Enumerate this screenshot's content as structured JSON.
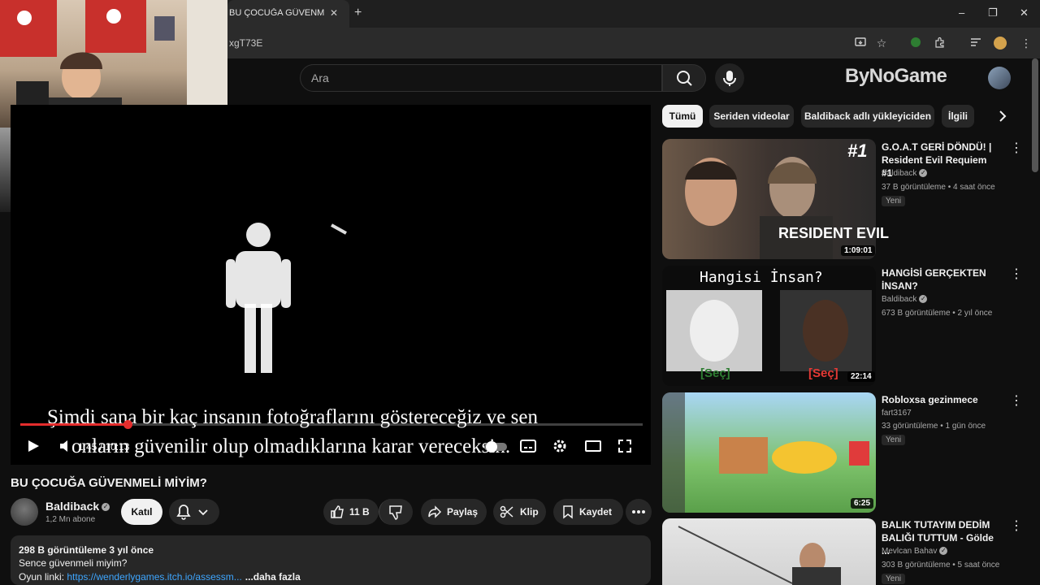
{
  "browser": {
    "tab_title": "BU ÇOCUĞA GÜVENMELİ MİYİM",
    "tab_close": "✕",
    "new_tab": "+",
    "url": "xgT73E",
    "win_min": "–",
    "win_max": "❐",
    "win_close": "✕"
  },
  "header": {
    "search_placeholder": "Ara",
    "watermark": "ByNoGame"
  },
  "player": {
    "time": "1:45 / 10:13",
    "progress_fraction": 0.172,
    "subtitle_line1": "Şimdi sana bir kaç insanın fotoğraflarını göstereceğiz ve sen",
    "subtitle_line2": "onların güvenilir olup olmadıklarına karar vereceksin."
  },
  "video": {
    "title": "BU ÇOCUĞA GÜVENMELİ MİYİM?",
    "channel": "Baldiback",
    "subscribers": "1,2 Mn abone",
    "join": "Katıl",
    "likes": "11 B",
    "share": "Paylaş",
    "clip": "Klip",
    "save": "Kaydet",
    "views_date": "298 B görüntüleme  3 yıl önce",
    "desc_line1": "Sence güvenmeli miyim?",
    "desc_prefix": "Oyun linki: ",
    "desc_link": "https://wenderlygames.itch.io/assessm...",
    "desc_more": "...daha fazla"
  },
  "chips": [
    "Tümü",
    "Seriden videolar",
    "Baldiback adlı yükleyiciden",
    "İlgili"
  ],
  "recommendations": [
    {
      "title": "G.O.A.T GERİ DÖNDÜ! | Resident Evil Requiem #1",
      "channel": "Baldiback",
      "meta": "37 B görüntüleme • 4 saat önce",
      "badge": "Yeni",
      "duration": "1:09:01",
      "thumb_text": "#1",
      "thumb_text2": "RESIDENT EVIL"
    },
    {
      "title": "HANGİSİ GERÇEKTEN İNSAN?",
      "channel": "Baldiback",
      "meta": "673 B görüntüleme • 2 yıl önce",
      "badge": "",
      "duration": "22:14",
      "thumb_text": "Hangisi İnsan?",
      "thumb_text2": "[Seç]"
    },
    {
      "title": "Robloxsa gezinmece",
      "channel": "fart3167",
      "meta": "33 görüntüleme • 1 gün önce",
      "badge": "Yeni",
      "duration": "6:25",
      "thumb_text": "",
      "thumb_text2": ""
    },
    {
      "title": "BALIK TUTAYIM DEDİM BALIĞI TUTTUM - Gölde ...",
      "channel": "Mevlcan Bahav",
      "meta": "303 B görüntüleme • 5 saat önce",
      "badge": "Yeni",
      "duration": "",
      "thumb_text": "",
      "thumb_text2": ""
    }
  ],
  "colors": {
    "accent_red": "#e52d2d",
    "bg": "#0f0f0f",
    "surface": "#272727"
  }
}
